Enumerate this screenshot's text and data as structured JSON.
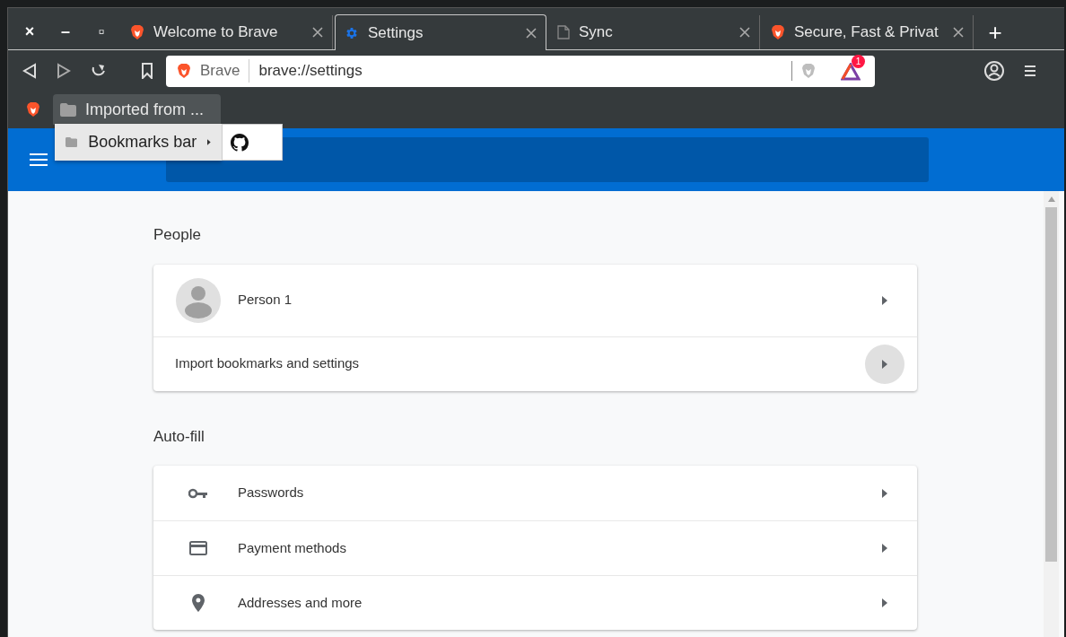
{
  "window_controls": [
    "×",
    "–",
    "▫"
  ],
  "tabs": [
    {
      "title": "Welcome to Brave",
      "selected": false
    },
    {
      "title": "Settings",
      "selected": true
    },
    {
      "title": "Sync",
      "selected": false
    },
    {
      "title": "Secure, Fast & Privat",
      "selected": false
    }
  ],
  "new_tab": "+",
  "address_bar": {
    "site": "Brave",
    "url": "brave://settings",
    "rewards_badge": "1"
  },
  "bookmarks_bar": {
    "folder": "Imported from ...",
    "folder_open": true
  },
  "bookmark_menu": {
    "items": [
      {
        "label": "Bookmarks bar"
      }
    ]
  },
  "sections": [
    {
      "title": "People",
      "rows": [
        {
          "kind": "profile",
          "label": "Person 1",
          "hovered": false
        },
        {
          "kind": "plain",
          "label": "Import bookmarks and settings",
          "hovered": true
        }
      ]
    },
    {
      "title": "Auto-fill",
      "rows": [
        {
          "kind": "key",
          "label": "Passwords",
          "hovered": false
        },
        {
          "kind": "card",
          "label": "Payment methods",
          "hovered": false
        },
        {
          "kind": "pin",
          "label": "Addresses and more",
          "hovered": false
        }
      ]
    }
  ]
}
